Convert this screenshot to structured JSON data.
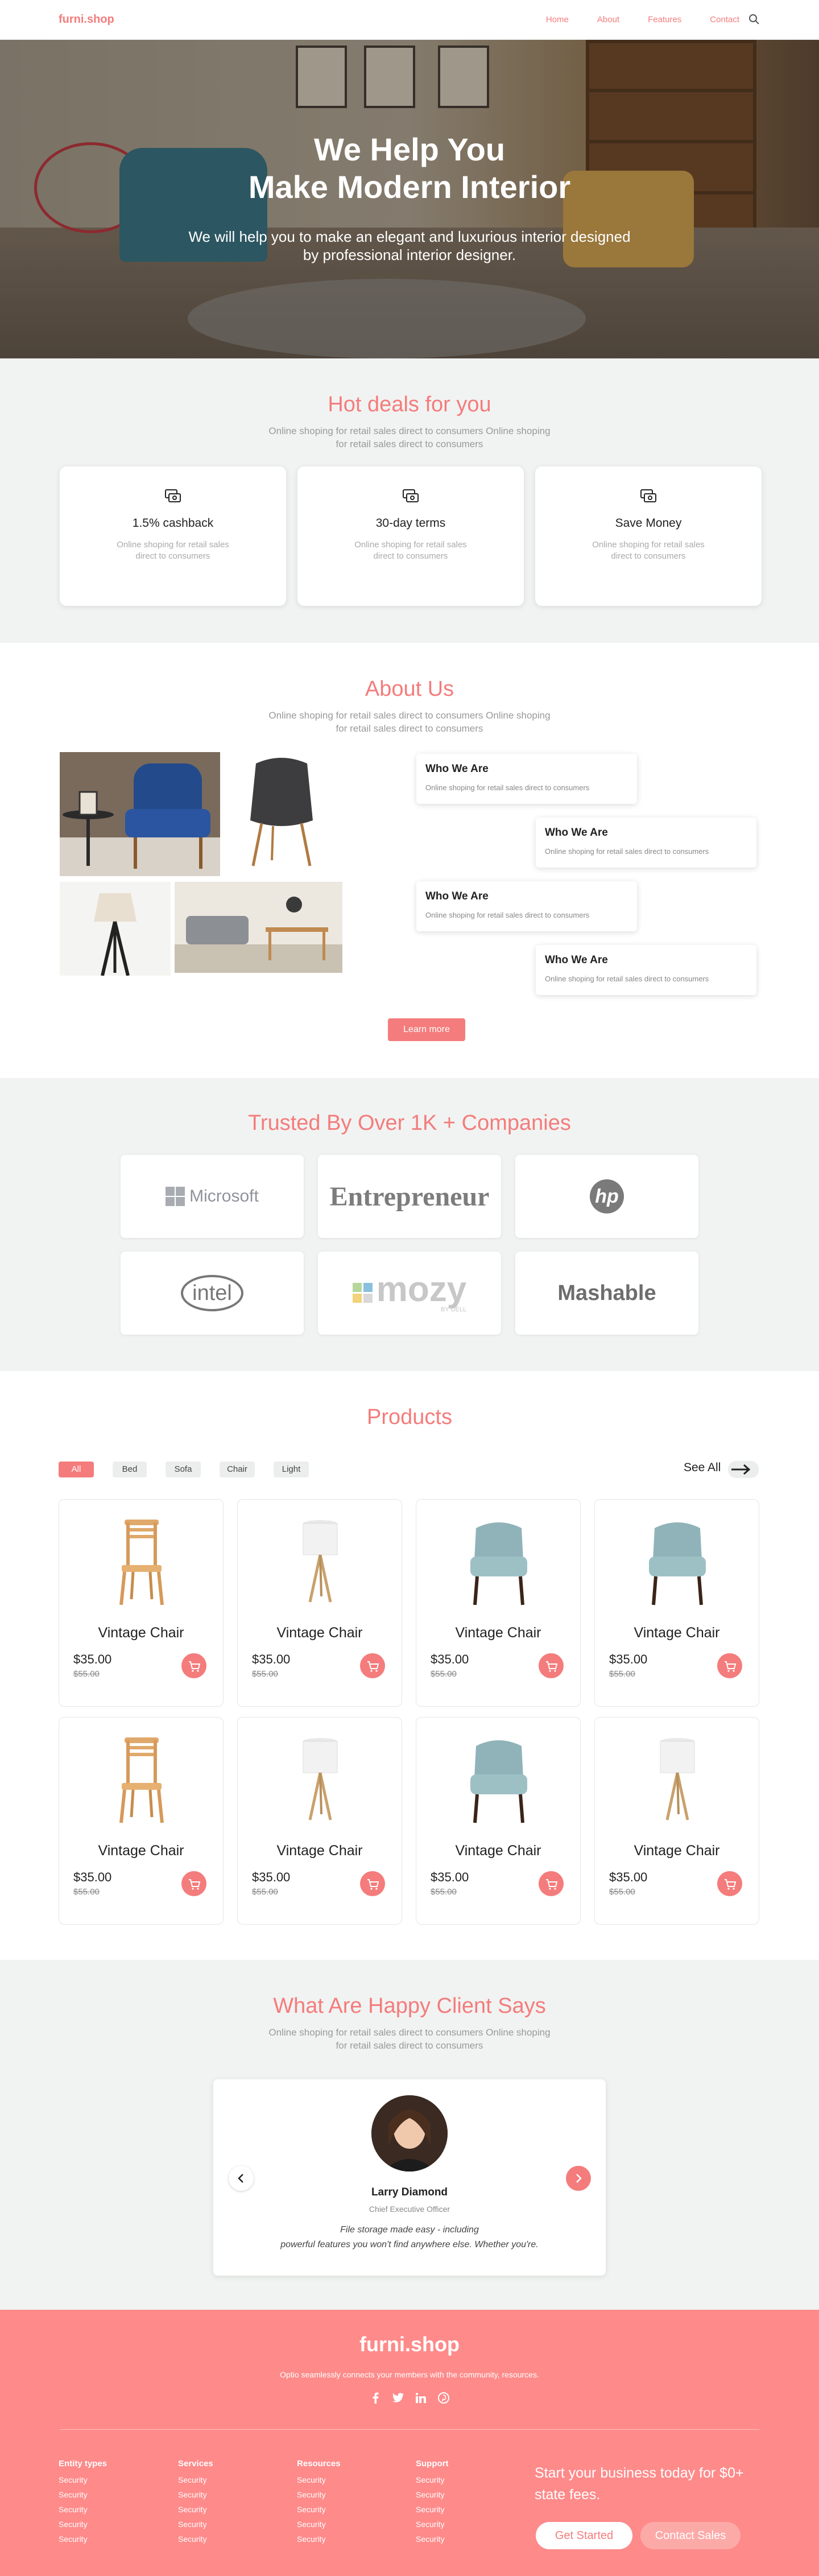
{
  "nav": {
    "logo": "furni.shop",
    "links": [
      "Home",
      "About",
      "Features",
      "Contact"
    ]
  },
  "hero": {
    "title_line1": "We Help You",
    "title_line2": "Make Modern Interior",
    "subtitle": "We will help you to make an elegant and luxurious interior designed by professional interior designer."
  },
  "deals": {
    "title": "Hot deals for you",
    "subtitle": "Online shoping for retail sales direct to consumers Online shoping for retail sales direct to consumers",
    "cards": [
      {
        "title": "1.5% cashback",
        "desc": "Online shoping for retail sales direct to consumers"
      },
      {
        "title": "30-day terms",
        "desc": "Online shoping for retail sales direct to consumers"
      },
      {
        "title": "Save Money",
        "desc": "Online shoping for retail sales direct to consumers"
      }
    ]
  },
  "about": {
    "title": "About Us",
    "subtitle": "Online shoping for retail sales direct to consumers Online shoping for retail sales direct to consumers",
    "items": [
      {
        "title": "Who We Are",
        "desc": "Online shoping for retail sales direct to consumers"
      },
      {
        "title": "Who We Are",
        "desc": "Online shoping for retail sales direct to consumers"
      },
      {
        "title": "Who We Are",
        "desc": "Online shoping for retail sales direct to consumers"
      },
      {
        "title": "Who We Are",
        "desc": "Online shoping for retail sales direct to consumers"
      }
    ],
    "button": "Learn more"
  },
  "trusted": {
    "title": "Trusted By Over 1K + Companies",
    "logos": [
      "Microsoft",
      "Entrepreneur",
      "hp",
      "intel",
      "mozy",
      "Mashable"
    ],
    "mozy_sub": "BY DELL"
  },
  "products": {
    "title": "Products",
    "filters": [
      "All",
      "Bed",
      "Sofa",
      "Chair",
      "Light"
    ],
    "see_all": "See All",
    "items": [
      {
        "name": "Vintage Chair",
        "price": "$35.00",
        "old": "$55.00",
        "kind": "wood-chair"
      },
      {
        "name": "Vintage Chair",
        "price": "$35.00",
        "old": "$55.00",
        "kind": "lamp"
      },
      {
        "name": "Vintage Chair",
        "price": "$35.00",
        "old": "$55.00",
        "kind": "arm-chair"
      },
      {
        "name": "Vintage Chair",
        "price": "$35.00",
        "old": "$55.00",
        "kind": "arm-chair"
      },
      {
        "name": "Vintage Chair",
        "price": "$35.00",
        "old": "$55.00",
        "kind": "wood-chair"
      },
      {
        "name": "Vintage Chair",
        "price": "$35.00",
        "old": "$55.00",
        "kind": "lamp"
      },
      {
        "name": "Vintage Chair",
        "price": "$35.00",
        "old": "$55.00",
        "kind": "arm-chair"
      },
      {
        "name": "Vintage Chair",
        "price": "$35.00",
        "old": "$55.00",
        "kind": "lamp"
      }
    ]
  },
  "testimonials": {
    "title": "What Are Happy Client Says",
    "subtitle": "Online shoping for retail sales direct to consumers Online shoping for retail sales direct to consumers",
    "name": "Larry Diamond",
    "role": "Chief Executive Officer",
    "quote_line1": "File storage made easy - including",
    "quote_line2": "powerful features you won't find anywhere else. Whether you're."
  },
  "footer": {
    "logo": "furni.shop",
    "tagline": "Optio seamlessly connects your members with the community, resources.",
    "columns": [
      {
        "heading": "Entity types",
        "items": [
          "Security",
          "Security",
          "Security",
          "Security",
          "Security"
        ]
      },
      {
        "heading": "Services",
        "items": [
          "Security",
          "Security",
          "Security",
          "Security",
          "Security"
        ]
      },
      {
        "heading": "Resources",
        "items": [
          "Security",
          "Security",
          "Security",
          "Security",
          "Security"
        ]
      },
      {
        "heading": "Support",
        "items": [
          "Security",
          "Security",
          "Security",
          "Security",
          "Security"
        ]
      }
    ],
    "cta": "Start your business today for $0+ state fees.",
    "btn_start": "Get Started",
    "btn_contact": "Contact Sales"
  },
  "colors": {
    "accent": "#f47c7c",
    "footer_bg": "#fe8a8a",
    "section_bg": "#f1f3f2"
  }
}
